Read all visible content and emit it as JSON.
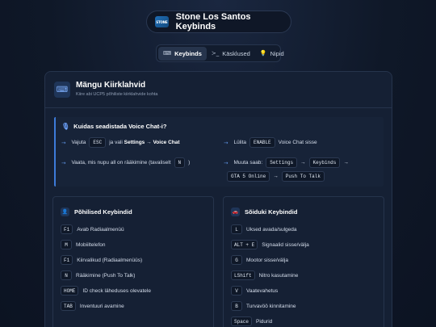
{
  "header": {
    "logo_text": "STONE",
    "title": "Stone Los Santos Keybinds"
  },
  "tabs": [
    {
      "label": "Keybinds",
      "icon": "keyboard-icon",
      "active": true
    },
    {
      "label": "Käsklused",
      "icon": "terminal-icon",
      "active": false
    },
    {
      "label": "Nipid",
      "icon": "lightbulb-icon",
      "active": false
    }
  ],
  "card": {
    "title": "Mängu Kiirklahvid",
    "subtitle": "Kiire abi UCP5 põhiliste kiirklahvide kohta"
  },
  "voice": {
    "title": "Kuidas seadistada Voice Chat-i?",
    "step1": {
      "pre": "Vajuta",
      "key": "ESC",
      "mid": "ja vali",
      "b1": "Settings",
      "sep": "→",
      "b2": "Voice Chat"
    },
    "step2": {
      "pre": "Lülita",
      "key": "ENABLE",
      "post": "Voice Chat sisse"
    },
    "step3": {
      "pre": "Vaata, mis nupu all on rääkimine (tavaliselt",
      "key": "N",
      "post": ")"
    },
    "step4": {
      "pre": "Muuta saab:",
      "k1": "Settings",
      "k2": "Keybinds",
      "k3": "GTA 5 Online",
      "k4": "Push To Talk",
      "sep": "→"
    }
  },
  "basic": {
    "title": "Põhilised Keybindid",
    "items": [
      {
        "key": "F1",
        "label": "Avab Radiaalmenüü"
      },
      {
        "key": "M",
        "label": "Mobiiltelefon"
      },
      {
        "key": "F1",
        "label": "Kiirvalikud (Radiaalmenüüs)"
      },
      {
        "key": "N",
        "label": "Rääkimine (Push To Talk)"
      },
      {
        "key": "HOME",
        "label": "ID check läheduses olevatele"
      },
      {
        "key": "TAB",
        "label": "Inventuuri avamine"
      }
    ]
  },
  "vehicle": {
    "title": "Sõiduki Keybindid",
    "items": [
      {
        "key": "L",
        "label": "Uksed avada/sulgeda"
      },
      {
        "key": "ALT + E",
        "label": "Signaalid sisse/välja"
      },
      {
        "key": "G",
        "label": "Mootor sisse/välja"
      },
      {
        "key": "LShift",
        "label": "Nitro kasutamine"
      },
      {
        "key": "V",
        "label": "Vaatevahetus"
      },
      {
        "key": "B",
        "label": "Turvavöö kinnitamine"
      },
      {
        "key": "Space",
        "label": "Pidurid"
      }
    ]
  }
}
